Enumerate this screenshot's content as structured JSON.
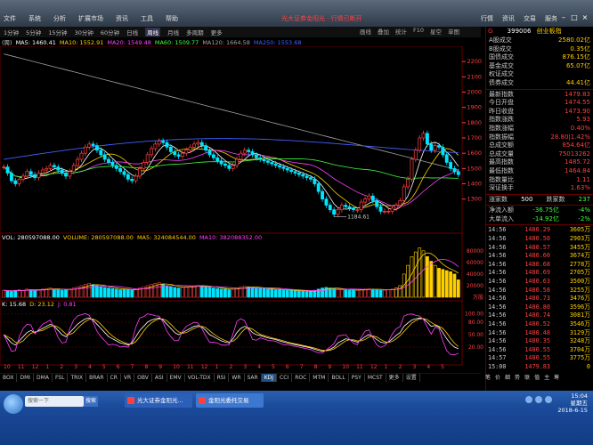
{
  "menu": [
    "文件",
    "系统",
    "分析",
    "扩展市场",
    "资讯",
    "工具",
    "帮助"
  ],
  "broker": "光大证券金阳光 · 行情已断开",
  "right_menu": [
    "行情",
    "资讯",
    "交易",
    "服务"
  ],
  "toolbar": [
    "1分钟",
    "5分钟",
    "15分钟",
    "30分钟",
    "60分钟",
    "日线",
    "周线",
    "月线",
    "多周期",
    "更多"
  ],
  "toolbar_active": "周线",
  "view_tabs": [
    "画线",
    "叠加",
    "统计",
    "F10",
    "星空",
    "单图"
  ],
  "ma_legend": {
    "prefix": "(周)",
    "items": [
      {
        "label": "MA5: 1460.41",
        "color": "#ffffff"
      },
      {
        "label": "MA10: 1552.91",
        "color": "#ffd000"
      },
      {
        "label": "MA20: 1549.48",
        "color": "#ff40ff"
      },
      {
        "label": "MA60: 1509.77",
        "color": "#40ff40"
      },
      {
        "label": "MA120: 1664.58",
        "color": "#a0a0a0"
      },
      {
        "label": "MA250: 1553.68",
        "color": "#4060ff"
      }
    ]
  },
  "vol_legend": {
    "items": [
      {
        "label": "VOL: 280597088.00",
        "color": "#ffffff"
      },
      {
        "label": "VOLUME: 280597088.00",
        "color": "#ffd000"
      },
      {
        "label": "MA5: 324084544.00",
        "color": "#ffd000"
      },
      {
        "label": "MA10: 382088352.00",
        "color": "#ff40ff"
      }
    ]
  },
  "kdj_legend": {
    "items": [
      {
        "label": "K: 15.68",
        "color": "#ffffff"
      },
      {
        "label": "D: 23.12",
        "color": "#ffd000"
      },
      {
        "label": "J: 0.81",
        "color": "#ff40ff"
      }
    ]
  },
  "low_label": "1184.61",
  "chart_data": {
    "type": "candlestick",
    "y_axis_price": [
      "2200",
      "2100",
      "2000",
      "1900",
      "1800",
      "1700",
      "1600",
      "1500",
      "1400",
      "1300"
    ],
    "y_axis_volume": [
      "80000",
      "60000",
      "40000",
      "20000"
    ],
    "volume_unit": "万股",
    "y_axis_kdj": [
      "100.00",
      "80.00",
      "50.00",
      "20.00"
    ],
    "x_ticks": [
      "10",
      "11",
      "12",
      "1",
      "2",
      "3",
      "4",
      "5",
      "6",
      "7",
      "8",
      "9",
      "10",
      "11",
      "12",
      "1",
      "2",
      "3",
      "4",
      "5",
      "6",
      "7",
      "8",
      "9",
      "10",
      "11",
      "12",
      "1",
      "2",
      "3",
      "4",
      "5"
    ],
    "close": [
      1510,
      1470,
      1420,
      1400,
      1430,
      1450,
      1480,
      1460,
      1440,
      1470,
      1490,
      1500,
      1520,
      1510,
      1490,
      1470,
      1450,
      1480,
      1520,
      1560,
      1600,
      1640,
      1660,
      1650,
      1620,
      1590,
      1560,
      1540,
      1520,
      1500,
      1480,
      1460,
      1430,
      1420,
      1450,
      1500,
      1540,
      1590,
      1630,
      1660,
      1680,
      1670,
      1640,
      1610,
      1590,
      1580,
      1600,
      1620,
      1640,
      1660,
      1670,
      1650,
      1620,
      1590,
      1570,
      1550,
      1530,
      1520,
      1500,
      1520,
      1560,
      1600,
      1620,
      1610,
      1590,
      1570,
      1560,
      1550,
      1540,
      1530,
      1520,
      1510,
      1500,
      1490,
      1480,
      1470,
      1460,
      1450,
      1440,
      1430,
      1400,
      1350,
      1300,
      1260,
      1230,
      1200,
      1230,
      1260,
      1250,
      1240,
      1230,
      1230,
      1280,
      1300,
      1320,
      1290,
      1250,
      1220,
      1220,
      1220,
      1240,
      1260,
      1290,
      1380,
      1430,
      1560,
      1620,
      1700,
      1730,
      1660,
      1620,
      1650,
      1640,
      1590,
      1540,
      1500,
      1480,
      1460
    ],
    "volume": [
      12,
      11,
      10,
      12,
      13,
      12,
      14,
      13,
      12,
      13,
      14,
      15,
      16,
      14,
      13,
      12,
      13,
      14,
      16,
      18,
      20,
      22,
      24,
      22,
      20,
      18,
      17,
      16,
      15,
      14,
      13,
      14,
      13,
      12,
      14,
      16,
      18,
      20,
      22,
      24,
      25,
      23,
      20,
      18,
      17,
      16,
      17,
      18,
      19,
      20,
      21,
      20,
      18,
      17,
      16,
      15,
      14,
      14,
      13,
      14,
      16,
      18,
      19,
      18,
      17,
      16,
      15,
      15,
      14,
      14,
      13,
      13,
      12,
      12,
      12,
      11,
      11,
      11,
      10,
      10,
      12,
      14,
      16,
      17,
      16,
      15,
      14,
      13,
      13,
      12,
      12,
      12,
      13,
      14,
      15,
      14,
      13,
      12,
      12,
      13,
      14,
      16,
      20,
      40,
      55,
      70,
      78,
      85,
      80,
      70,
      62,
      55,
      50,
      48,
      46,
      44,
      40,
      30
    ],
    "kdj_k": [
      50,
      40,
      30,
      25,
      35,
      45,
      55,
      60,
      55,
      60,
      65,
      70,
      75,
      70,
      60,
      50,
      45,
      55,
      65,
      75,
      82,
      88,
      90,
      85,
      75,
      65,
      55,
      45,
      40,
      35,
      30,
      28,
      25,
      30,
      45,
      60,
      70,
      80,
      85,
      88,
      90,
      85,
      75,
      65,
      55,
      50,
      55,
      60,
      65,
      70,
      72,
      68,
      60,
      50,
      45,
      40,
      35,
      32,
      30,
      40,
      55,
      65,
      70,
      65,
      55,
      50,
      48,
      45,
      42,
      40,
      38,
      35,
      32,
      30,
      28,
      26,
      24,
      22,
      20,
      18,
      15,
      12,
      10,
      12,
      15,
      20,
      30,
      35,
      40,
      38,
      35,
      32,
      38,
      45,
      50,
      45,
      38,
      32,
      30,
      32,
      40,
      48,
      55,
      70,
      78,
      85,
      88,
      90,
      88,
      80,
      70,
      72,
      68,
      55,
      40,
      28,
      20,
      16
    ]
  },
  "quote_panel": {
    "code": "399006",
    "name": "创业板指",
    "flag": "G",
    "top_rows": [
      {
        "label": "A股成交",
        "value": "2580.02亿"
      },
      {
        "label": "B股成交",
        "value": "0.35亿"
      },
      {
        "label": "国债成交",
        "value": "876.15亿"
      },
      {
        "label": "基金成交",
        "value": "65.07亿"
      },
      {
        "label": "权证成交",
        "value": ""
      },
      {
        "label": "债券成交",
        "value": "44.41亿"
      }
    ],
    "mid_rows": [
      {
        "label": "最新指数",
        "value": "1479.83"
      },
      {
        "label": "今日开盘",
        "value": "1474.55"
      },
      {
        "label": "昨日收盘",
        "value": "1473.90"
      },
      {
        "label": "指数涨跌",
        "value": "5.93"
      },
      {
        "label": "指数涨幅",
        "value": "0.40%"
      },
      {
        "label": "指数振幅",
        "value": "28.80|1.42%"
      },
      {
        "label": "总成交额",
        "value": "854.64亿"
      },
      {
        "label": "总成交量",
        "value": "75013262"
      },
      {
        "label": "最高指数",
        "value": "1485.72"
      },
      {
        "label": "最低指数",
        "value": "1464.84"
      },
      {
        "label": "指数量比",
        "value": "1.11"
      },
      {
        "label": "深证换手",
        "value": "1.63%"
      }
    ],
    "updown": {
      "up_label": "涨家数",
      "up": "500",
      "down_label": "跌家数",
      "down": "237"
    },
    "flows": [
      {
        "label": "净流入额",
        "value": "-36.75亿",
        "pct": "-4%"
      },
      {
        "label": "大单流入",
        "value": "-14.92亿",
        "pct": "-2%"
      }
    ],
    "ticks": [
      {
        "t": "14:56",
        "p": "1480.29",
        "q": "3605万"
      },
      {
        "t": "14:56",
        "p": "1480.50",
        "q": "2903万"
      },
      {
        "t": "14:56",
        "p": "1480.57",
        "q": "3455万"
      },
      {
        "t": "14:56",
        "p": "1480.60",
        "q": "3674万"
      },
      {
        "t": "14:56",
        "p": "1480.68",
        "q": "2778万"
      },
      {
        "t": "14:56",
        "p": "1480.69",
        "q": "2705万"
      },
      {
        "t": "14:56",
        "p": "1480.63",
        "q": "3500万"
      },
      {
        "t": "14:56",
        "p": "1480.58",
        "q": "3255万"
      },
      {
        "t": "14:56",
        "p": "1480.73",
        "q": "3476万"
      },
      {
        "t": "14:56",
        "p": "1480.80",
        "q": "3596万"
      },
      {
        "t": "14:56",
        "p": "1480.74",
        "q": "3081万"
      },
      {
        "t": "14:56",
        "p": "1480.52",
        "q": "3546万"
      },
      {
        "t": "14:56",
        "p": "1480.48",
        "q": "3129万"
      },
      {
        "t": "14:56",
        "p": "1480.35",
        "q": "3248万"
      },
      {
        "t": "14:56",
        "p": "1480.55",
        "q": "3704万"
      },
      {
        "t": "14:57",
        "p": "1480.55",
        "q": "3775万"
      },
      {
        "t": "15:00",
        "p": "1479.83",
        "q": "0"
      }
    ]
  },
  "bottom_tabs": [
    "BOX",
    "DMI",
    "DMA",
    "FSL",
    "TRIX",
    "BRAR",
    "CR",
    "VR",
    "OBV",
    "ASI",
    "EMV",
    "VOL-TDX",
    "RSI",
    "WR",
    "SAR",
    "KDJ",
    "CCI",
    "ROC",
    "MTM",
    "BOLL",
    "PSY",
    "MCST",
    "更多",
    "设置"
  ],
  "bottom_tab_selected": "KDJ",
  "panel_tabs": [
    "笔",
    "价",
    "细",
    "势",
    "联",
    "值",
    "主",
    "筹"
  ],
  "taskbar": {
    "search_placeholder": "搜索一下",
    "search_button": "搜索",
    "items": [
      "光大证券金阳光...",
      "金阳光委托交易"
    ],
    "time": "15:04",
    "date": "2018-6-15",
    "weekday": "星期五"
  }
}
